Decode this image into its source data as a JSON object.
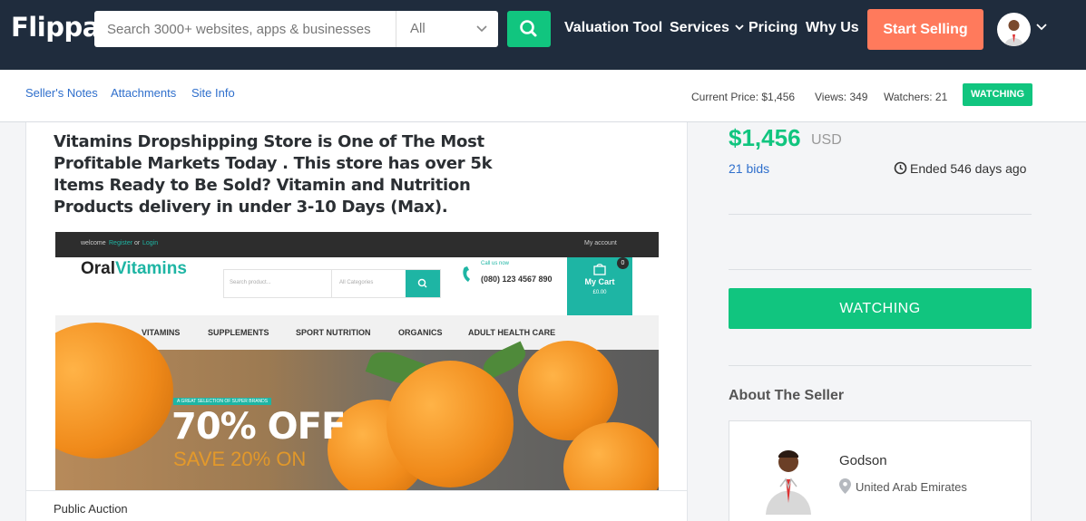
{
  "header": {
    "logo": "Flippa",
    "search_placeholder": "Search 3000+ websites, apps & businesses",
    "category": "All",
    "nav": [
      "Valuation Tool",
      "Services",
      "Pricing",
      "Why Us"
    ],
    "start_selling": "Start Selling"
  },
  "subnav": {
    "links": [
      "Seller's Notes",
      "Attachments",
      "Site Info"
    ],
    "current_price": "Current Price: $1,456",
    "views": "Views: 349",
    "watchers": "Watchers: 21",
    "watching_badge": "WATCHING"
  },
  "listing": {
    "title": "Vitamins Dropshipping Store is One of The Most Profitable Markets Today . This store has over 5k Items Ready to Be Sold? Vitamin and Nutrition Products delivery in under 3-10 Days (Max).",
    "footer_label": "Public Auction",
    "screenshot": {
      "welcome": "welcome",
      "register": "Register",
      "or": "or",
      "login": "Login",
      "my_account": "My account",
      "brand_a": "Oral",
      "brand_b": "Vitamins",
      "search_placeholder": "Search product...",
      "all_categories": "All Categories",
      "call_us": "Call us now",
      "phone": "(080) 123 4567 890",
      "cart_label": "My Cart",
      "cart_total": "£0.00",
      "cart_count": "0",
      "menu": [
        "VITAMINS",
        "SUPPLEMENTS",
        "SPORT NUTRITION",
        "ORGANICS",
        "ADULT HEALTH CARE"
      ],
      "promo_tag": "A GREAT SELECTION OF SUPER BRANDS",
      "promo_big": "70% OFF",
      "promo_sub": "SAVE 20% ON"
    }
  },
  "sidebar": {
    "price": "$1,456",
    "currency": "USD",
    "bids": "21 bids",
    "ended": "Ended 546 days ago",
    "watch_button": "WATCHING",
    "about_heading": "About The Seller",
    "seller_name": "Godson",
    "seller_location": "United Arab Emirates"
  },
  "colors": {
    "navy": "#1f2c3d",
    "green": "#11c57f",
    "coral": "#ff7a5c",
    "link_blue": "#2f6fcc",
    "teal": "#1eb5a4"
  }
}
